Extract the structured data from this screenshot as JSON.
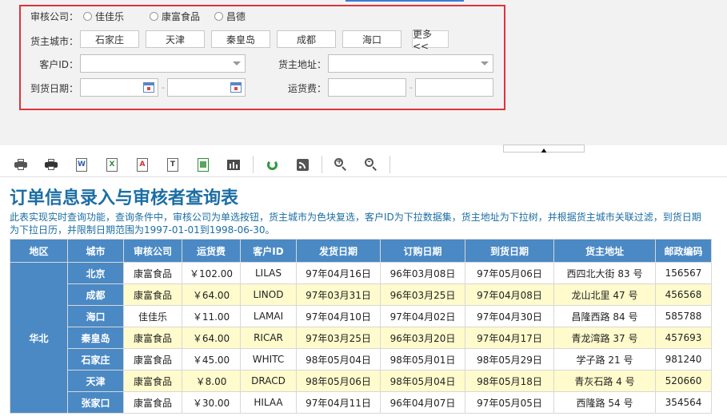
{
  "filters": {
    "company": {
      "label": "审核公司：",
      "options": [
        "佳佳乐",
        "康富食品",
        "昌德"
      ]
    },
    "city": {
      "label": "货主城市：",
      "buttons": [
        "石家庄",
        "天津",
        "秦皇岛",
        "成都",
        "海口"
      ],
      "more": "更多<<"
    },
    "customer_id": {
      "label": "客户ID：",
      "value": ""
    },
    "address": {
      "label": "货主地址：",
      "value": ""
    },
    "arrival_date": {
      "label": "到货日期：",
      "from": "",
      "to": ""
    },
    "freight": {
      "label": "运货费：",
      "from": "",
      "to": ""
    }
  },
  "toolbar": {
    "icons": [
      "print-icon",
      "print-preview-icon",
      "export-word-icon",
      "export-excel-icon",
      "export-pdf-icon",
      "export-text-icon",
      "export-image-icon",
      "chart-icon",
      "refresh-icon",
      "rss-icon",
      "zoom-in-icon",
      "zoom-out-icon"
    ],
    "labels": {
      "word": "W",
      "excel": "X",
      "pdf": "A",
      "text": "T"
    }
  },
  "report": {
    "title": "订单信息录入与审核者查询表",
    "description": "此表实现实时查询功能，查询条件中，审核公司为单选按钮，货主城市为色块复选，客户ID为下拉数据集，货主地址为下拉树，并根据货主城市关联过滤，到货日期为下拉日历，并限制日期范围为1997-01-01到1998-06-30。",
    "columns": [
      "地区",
      "城市",
      "审核公司",
      "运货费",
      "客户ID",
      "发货日期",
      "订购日期",
      "到货日期",
      "货主地址",
      "邮政编码"
    ],
    "region": "华北",
    "rows": [
      [
        "北京",
        "康富食品",
        "￥102.00",
        "LILAS",
        "97年04月16日",
        "96年03月08日",
        "97年05月06日",
        "西四北大街 83 号",
        "156567"
      ],
      [
        "成都",
        "康富食品",
        "￥64.00",
        "LINOD",
        "97年03月31日",
        "96年03月25日",
        "97年04月08日",
        "龙山北里 47 号",
        "456568"
      ],
      [
        "海口",
        "佳佳乐",
        "￥11.00",
        "LAMAI",
        "97年04月10日",
        "97年04月02日",
        "97年04月30日",
        "昌隆西路 84 号",
        "585788"
      ],
      [
        "秦皇岛",
        "康富食品",
        "￥64.00",
        "RICAR",
        "97年03月25日",
        "96年03月20日",
        "97年04月17日",
        "青龙湾路 37 号",
        "457693"
      ],
      [
        "石家庄",
        "康富食品",
        "￥45.00",
        "WHITC",
        "98年05月04日",
        "98年05月01日",
        "98年05月29日",
        "学子路 21 号",
        "981240"
      ],
      [
        "天津",
        "康富食品",
        "￥8.00",
        "DRACD",
        "98年05月06日",
        "98年05月04日",
        "98年05月18日",
        "青灰石路 4 号",
        "520660"
      ],
      [
        "张家口",
        "康富食品",
        "￥30.00",
        "HILAA",
        "97年04月11日",
        "96年04月07日",
        "97年05月05日",
        "西隆路 54 号",
        "354564"
      ]
    ]
  }
}
